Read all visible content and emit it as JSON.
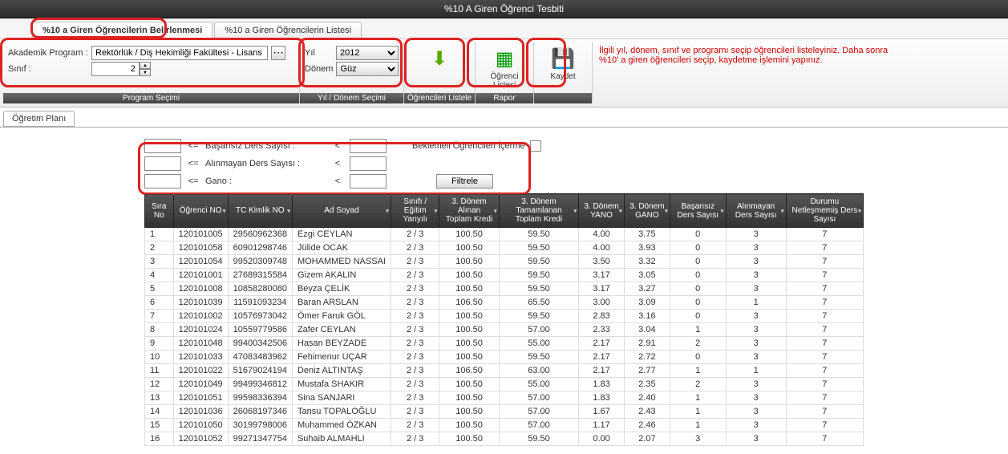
{
  "window": {
    "title": "%10 A Giren Öğrenci Tesbiti"
  },
  "tabs": {
    "t1": "%10 a Giren Öğrencilerin Belirlenmesi",
    "t2": "%10 a Giren Öğrencilerin Listesi"
  },
  "program_group": {
    "title": "Program Seçimi",
    "prog_label": "Akademik Program :",
    "prog_value": "Rektörlük / Diş Hekimliği Fakültesi - Lisans",
    "sinif_label": "Sınıf :",
    "sinif_value": "2"
  },
  "term_group": {
    "title": "Yıl / Dönem Seçimi",
    "yil_label": "Yıl",
    "yil_value": "2012",
    "donem_label": "Dönem",
    "donem_value": "Güz"
  },
  "btn_list": {
    "label": "Öğrencileri Listele"
  },
  "btn_report": {
    "group": "Rapor",
    "l1": "Öğrenci",
    "l2": "Listesi"
  },
  "btn_save": {
    "label": "Kaydet"
  },
  "info": "İlgili yıl, dönem, sınıf ve programı  seçip öğrencileri listeleyiniz. Daha sonra %10' a giren öğrencileri seçip, kaydetme işlemini yapınız.",
  "subtab": "Öğretim Planı",
  "filters": {
    "f1": "Başarısız Ders Sayısı :",
    "f2": "Alınmayan Ders Sayısı :",
    "f3": "Gano :",
    "lte": "<=",
    "lt": "<",
    "bek": "Beklemeli Öğrencileri İçerme",
    "btn": "Filtrele"
  },
  "columns": {
    "c0": "Sıra No",
    "c1": "Öğrenci NO",
    "c2": "TC Kimlik NO",
    "c3": "Ad Soyad",
    "c4": "Sınıfı / Eğitim Yarıyılı",
    "c5": "3. Dönem Alınan Toplam Kredi",
    "c6": "3. Dönem Tamamlanan Toplam Kredi",
    "c7": "3. Dönem YANO",
    "c8": "3. Dönem GANO",
    "c9": "Başarısız Ders Sayısı",
    "c10": "Alınmayan Ders Sayısı",
    "c11": "Durumu Netleşmemiş Ders Sayısı"
  },
  "rows": [
    {
      "n": "1",
      "ogr": "120101005",
      "tc": "29560962368",
      "ad": "Ezgi CEYLAN",
      "sy": "2 / 3",
      "ak": "100.50",
      "tk": "59.50",
      "yano": "4.00",
      "gano": "3.75",
      "bd": "0",
      "ad2": "3",
      "dn": "7"
    },
    {
      "n": "2",
      "ogr": "120101058",
      "tc": "60901298746",
      "ad": "Jülide OCAK",
      "sy": "2 / 3",
      "ak": "100.50",
      "tk": "59.50",
      "yano": "4.00",
      "gano": "3.93",
      "bd": "0",
      "ad2": "3",
      "dn": "7"
    },
    {
      "n": "3",
      "ogr": "120101054",
      "tc": "99520309748",
      "ad": "MOHAMMED NASSAI",
      "sy": "2 / 3",
      "ak": "100.50",
      "tk": "59.50",
      "yano": "3.50",
      "gano": "3.32",
      "bd": "0",
      "ad2": "3",
      "dn": "7"
    },
    {
      "n": "4",
      "ogr": "120101001",
      "tc": "27689315584",
      "ad": "Gizem AKALIN",
      "sy": "2 / 3",
      "ak": "100.50",
      "tk": "59.50",
      "yano": "3.17",
      "gano": "3.05",
      "bd": "0",
      "ad2": "3",
      "dn": "7"
    },
    {
      "n": "5",
      "ogr": "120101008",
      "tc": "10858280080",
      "ad": "Beyza ÇELİK",
      "sy": "2 / 3",
      "ak": "100.50",
      "tk": "59.50",
      "yano": "3.17",
      "gano": "3.27",
      "bd": "0",
      "ad2": "3",
      "dn": "7"
    },
    {
      "n": "6",
      "ogr": "120101039",
      "tc": "11591093234",
      "ad": "Baran ARSLAN",
      "sy": "2 / 3",
      "ak": "106.50",
      "tk": "65.50",
      "yano": "3.00",
      "gano": "3.09",
      "bd": "0",
      "ad2": "1",
      "dn": "7"
    },
    {
      "n": "7",
      "ogr": "120101002",
      "tc": "10576973042",
      "ad": "Ömer Faruk GÖL",
      "sy": "2 / 3",
      "ak": "100.50",
      "tk": "59.50",
      "yano": "2.83",
      "gano": "3.16",
      "bd": "0",
      "ad2": "3",
      "dn": "7"
    },
    {
      "n": "8",
      "ogr": "120101024",
      "tc": "10559779586",
      "ad": "Zafer CEYLAN",
      "sy": "2 / 3",
      "ak": "100.50",
      "tk": "57.00",
      "yano": "2.33",
      "gano": "3.04",
      "bd": "1",
      "ad2": "3",
      "dn": "7"
    },
    {
      "n": "9",
      "ogr": "120101048",
      "tc": "99400342506",
      "ad": "Hasan BEYZADE",
      "sy": "2 / 3",
      "ak": "100.50",
      "tk": "55.00",
      "yano": "2.17",
      "gano": "2.91",
      "bd": "2",
      "ad2": "3",
      "dn": "7"
    },
    {
      "n": "10",
      "ogr": "120101033",
      "tc": "47083483962",
      "ad": "Fehimenur UÇAR",
      "sy": "2 / 3",
      "ak": "100.50",
      "tk": "59.50",
      "yano": "2.17",
      "gano": "2.72",
      "bd": "0",
      "ad2": "3",
      "dn": "7"
    },
    {
      "n": "11",
      "ogr": "120101022",
      "tc": "51679024194",
      "ad": "Deniz ALTINTAŞ",
      "sy": "2 / 3",
      "ak": "106.50",
      "tk": "63.00",
      "yano": "2.17",
      "gano": "2.77",
      "bd": "1",
      "ad2": "1",
      "dn": "7"
    },
    {
      "n": "12",
      "ogr": "120101049",
      "tc": "99499346812",
      "ad": "Mustafa SHAKIR",
      "sy": "2 / 3",
      "ak": "100.50",
      "tk": "55.00",
      "yano": "1.83",
      "gano": "2.35",
      "bd": "2",
      "ad2": "3",
      "dn": "7"
    },
    {
      "n": "13",
      "ogr": "120101051",
      "tc": "99598336394",
      "ad": "Sina SANJARI",
      "sy": "2 / 3",
      "ak": "100.50",
      "tk": "57.00",
      "yano": "1.83",
      "gano": "2.40",
      "bd": "1",
      "ad2": "3",
      "dn": "7"
    },
    {
      "n": "14",
      "ogr": "120101036",
      "tc": "26068197346",
      "ad": "Tansu TOPALOĞLU",
      "sy": "2 / 3",
      "ak": "100.50",
      "tk": "57.00",
      "yano": "1.67",
      "gano": "2.43",
      "bd": "1",
      "ad2": "3",
      "dn": "7"
    },
    {
      "n": "15",
      "ogr": "120101050",
      "tc": "30199798006",
      "ad": "Muhammed ÖZKAN",
      "sy": "2 / 3",
      "ak": "100.50",
      "tk": "57.00",
      "yano": "1.17",
      "gano": "2.46",
      "bd": "1",
      "ad2": "3",
      "dn": "7"
    },
    {
      "n": "16",
      "ogr": "120101052",
      "tc": "99271347754",
      "ad": "Suhaib ALMAHLI",
      "sy": "2 / 3",
      "ak": "100.50",
      "tk": "59.50",
      "yano": "0.00",
      "gano": "2.07",
      "bd": "3",
      "ad2": "3",
      "dn": "7"
    }
  ]
}
